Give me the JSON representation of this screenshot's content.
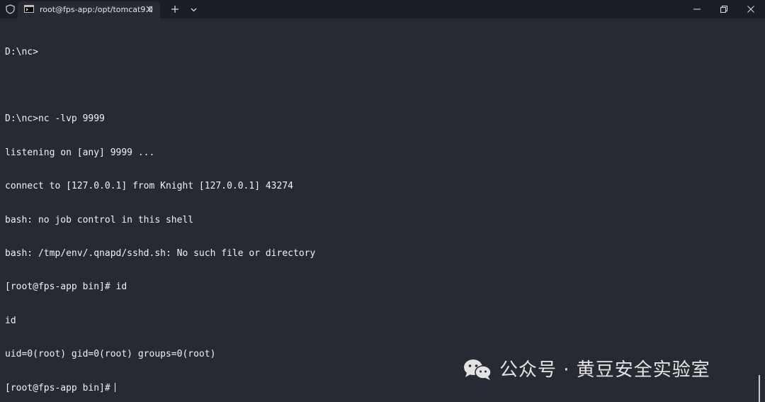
{
  "window": {
    "tab_title": "root@fps-app:/opt/tomcat9.0",
    "icons": {
      "shield": "shield-icon",
      "terminal": "terminal-icon",
      "close_tab": "close-icon",
      "new_tab": "plus-icon",
      "dropdown": "chevron-down-icon",
      "minimize": "minimize-icon",
      "maximize": "restore-icon",
      "close": "close-icon"
    }
  },
  "terminal": {
    "lines": [
      "D:\\nc>",
      "",
      "D:\\nc>nc -lvp 9999",
      "listening on [any] 9999 ...",
      "connect to [127.0.0.1] from Knight [127.0.0.1] 43274",
      "bash: no job control in this shell",
      "bash: /tmp/env/.qnapd/sshd.sh: No such file or directory",
      "[root@fps-app bin]# id",
      "id",
      "uid=0(root) gid=0(root) groups=0(root)"
    ],
    "current_prompt": "[root@fps-app bin]#"
  },
  "watermark": {
    "text": "公众号 · 黄豆安全实验室"
  },
  "colors": {
    "background": "#272a33",
    "titlebar": "#1c1e26",
    "foreground": "#f2f2f2"
  }
}
